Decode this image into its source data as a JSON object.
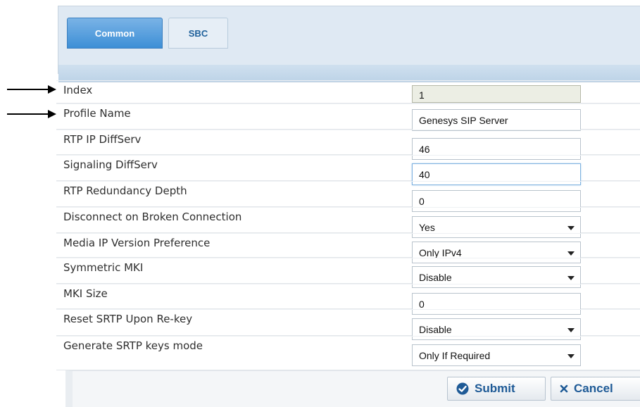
{
  "tabs": [
    {
      "label": "Common"
    },
    {
      "label": "SBC"
    }
  ],
  "fields": [
    {
      "label": "Index",
      "value": "1"
    },
    {
      "label": "Profile Name",
      "value": "Genesys SIP Server"
    },
    {
      "label": "RTP IP DiffServ",
      "value": "46"
    },
    {
      "label": "Signaling DiffServ",
      "value": "40"
    },
    {
      "label": "RTP Redundancy Depth",
      "value": "0"
    },
    {
      "label": "Disconnect on Broken Connection",
      "value": "Yes"
    },
    {
      "label": "Media IP Version Preference",
      "value": "Only IPv4"
    },
    {
      "label": "Symmetric MKI",
      "value": "Disable"
    },
    {
      "label": "MKI Size",
      "value": "0"
    },
    {
      "label": "Reset SRTP Upon Re-key",
      "value": "Disable"
    },
    {
      "label": "Generate SRTP keys mode",
      "value": "Only If Required"
    }
  ],
  "buttons": {
    "submit": "Submit",
    "cancel": "Cancel"
  },
  "icons": {
    "submit": "check-circle-icon",
    "cancel": "x-icon"
  },
  "colors": {
    "accent": "#3d8fd6",
    "button_text": "#1e5a96"
  }
}
